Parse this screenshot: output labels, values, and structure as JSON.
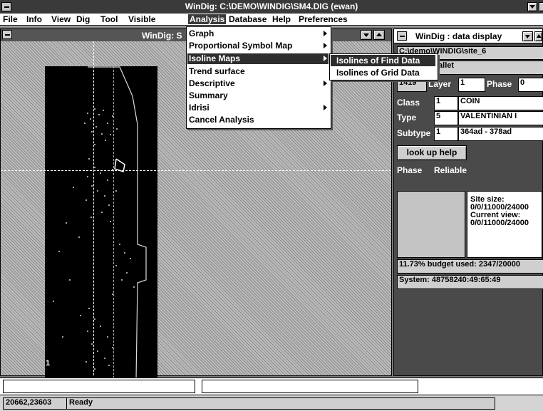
{
  "window": {
    "title": "WinDig: C:\\DEMO\\WINDIG\\SM4.DIG (ewan)"
  },
  "menubar": {
    "items": [
      {
        "label": "File"
      },
      {
        "label": "Info"
      },
      {
        "label": "View"
      },
      {
        "label": "Dig"
      },
      {
        "label": "Tool"
      },
      {
        "label": "Visible"
      },
      {
        "label": "Analysis"
      },
      {
        "label": "Database"
      },
      {
        "label": "Help"
      },
      {
        "label": "Preferences"
      }
    ]
  },
  "map_window": {
    "title": "WinDig: S",
    "corner_label": "1"
  },
  "analysis_menu": {
    "items": [
      {
        "label": "Graph"
      },
      {
        "label": "Proportional Symbol Map"
      },
      {
        "label": "Isoline Maps"
      },
      {
        "label": "Trend surface"
      },
      {
        "label": "Descriptive"
      },
      {
        "label": "Summary"
      },
      {
        "label": "Idrisi"
      },
      {
        "label": "Cancel Analysis"
      }
    ]
  },
  "isoline_submenu": {
    "items": [
      {
        "label": "Isolines of Find Data"
      },
      {
        "label": "Isolines of Grid Data"
      }
    ]
  },
  "data_panel": {
    "title": "WinDig : data display",
    "path": "C:\\demo\\WINDIG\\site_6",
    "name": "lallet",
    "id": "1419",
    "layer_label": "Layer",
    "layer": "1",
    "phase_label": "Phase",
    "phase": "0",
    "class_label": "Class",
    "class_code": "1",
    "class_value": "COIN",
    "type_label": "Type",
    "type_code": "5",
    "type_value": "VALENTINIAN I",
    "subtype_label": "Subtype",
    "subtype_code": "1",
    "subtype_value": "364ad - 378ad",
    "lookup_button": "look up help",
    "phase_header": "Phase",
    "reliable_header": "Reliable",
    "site_size_label": "Site size:",
    "site_size": "0/0/11000/24000",
    "current_view_label": "Current view:",
    "current_view": "0/0/11000/24000",
    "budget": "11.73% budget used: 2347/20000",
    "system": "System: 48758240:49:65:49"
  },
  "statusbar": {
    "coords": "20662,23603",
    "status": "Ready"
  }
}
